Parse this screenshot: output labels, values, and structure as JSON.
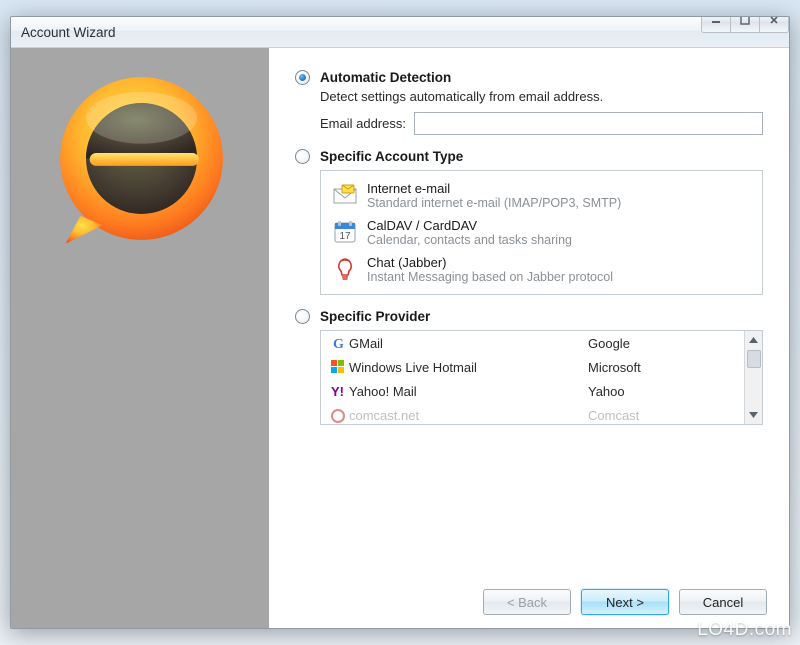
{
  "window": {
    "title": "Account Wizard"
  },
  "sections": {
    "automatic": {
      "title": "Automatic Detection",
      "desc": "Detect settings automatically from email address.",
      "field_label": "Email address:",
      "value": ""
    },
    "specific_type": {
      "title": "Specific Account Type",
      "items": [
        {
          "label": "Internet e-mail",
          "sub": "Standard internet e-mail (IMAP/POP3, SMTP)",
          "icon": "envelope-icon"
        },
        {
          "label": "CalDAV / CardDAV",
          "sub": "Calendar, contacts and tasks sharing",
          "icon": "calendar-icon"
        },
        {
          "label": "Chat (Jabber)",
          "sub": "Instant Messaging based on Jabber protocol",
          "icon": "bulb-icon"
        }
      ]
    },
    "provider": {
      "title": "Specific Provider",
      "items": [
        {
          "name": "GMail",
          "company": "Google",
          "icon": "gmail-icon"
        },
        {
          "name": "Windows Live Hotmail",
          "company": "Microsoft",
          "icon": "winlive-icon"
        },
        {
          "name": "Yahoo! Mail",
          "company": "Yahoo",
          "icon": "yahoo-icon"
        },
        {
          "name": "comcast.net",
          "company": "Comcast",
          "icon": "comcast-icon"
        }
      ]
    }
  },
  "buttons": {
    "back": "< Back",
    "next": "Next >",
    "cancel": "Cancel"
  },
  "watermark": "LO4D.com"
}
